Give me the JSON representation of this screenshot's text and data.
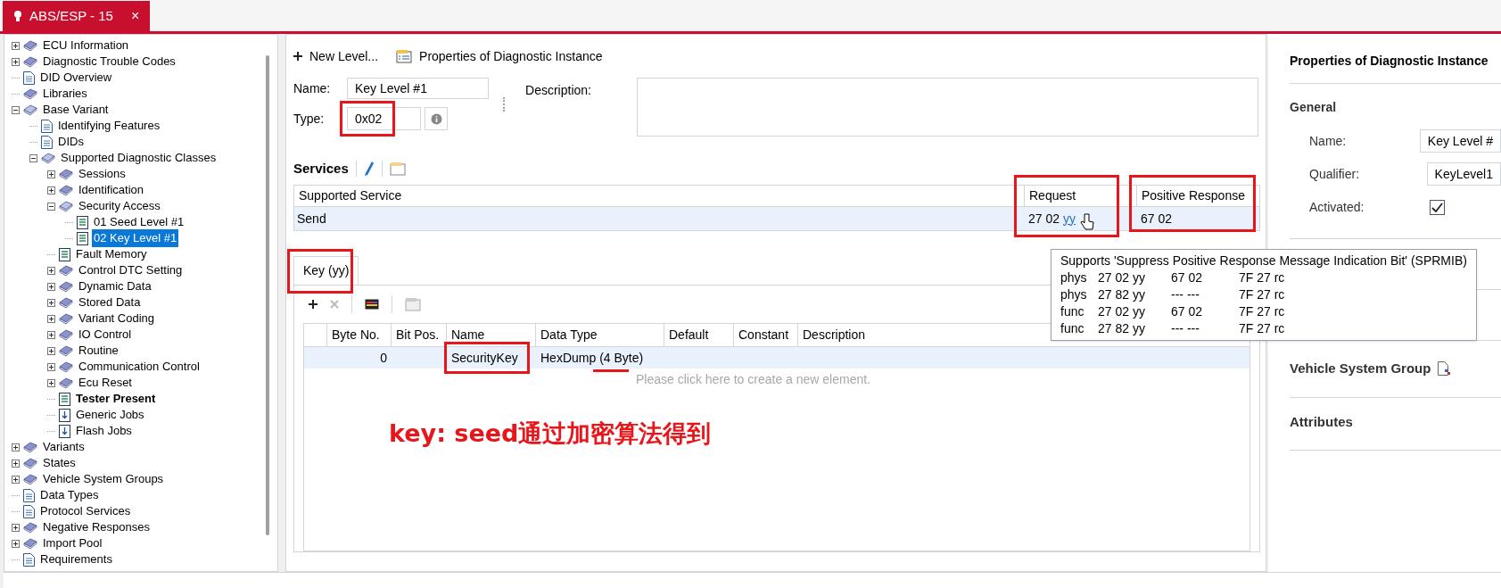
{
  "document_tab": {
    "title": "ABS/ESP - 15",
    "close": "×",
    "selected": true
  },
  "tree": [
    {
      "label": "ECU Information",
      "kind": "book",
      "expanded": false
    },
    {
      "label": "Diagnostic Trouble Codes",
      "kind": "book",
      "expanded": false
    },
    {
      "label": "DID Overview",
      "kind": "page"
    },
    {
      "label": "Libraries",
      "kind": "book"
    },
    {
      "label": "Base Variant",
      "kind": "openbook",
      "expanded": true,
      "children": [
        {
          "label": "Identifying Features",
          "kind": "page"
        },
        {
          "label": "DIDs",
          "kind": "page"
        },
        {
          "label": "Supported Diagnostic Classes",
          "kind": "openbook",
          "expanded": true,
          "children": [
            {
              "label": "Sessions",
              "kind": "book",
              "expanded": false
            },
            {
              "label": "Identification",
              "kind": "book",
              "expanded": false
            },
            {
              "label": "Security Access",
              "kind": "openbook",
              "expanded": true,
              "children": [
                {
                  "label": "01 Seed Level #1",
                  "kind": "sheet",
                  "selected": false
                },
                {
                  "label": "02 Key Level #1",
                  "kind": "sheet",
                  "selected": true
                }
              ]
            },
            {
              "label": "Fault Memory",
              "kind": "sheet"
            },
            {
              "label": "Control DTC Setting",
              "kind": "book",
              "expanded": false
            },
            {
              "label": "Dynamic Data",
              "kind": "book",
              "expanded": false
            },
            {
              "label": "Stored Data",
              "kind": "book",
              "expanded": false
            },
            {
              "label": "Variant Coding",
              "kind": "book",
              "expanded": false
            },
            {
              "label": "IO Control",
              "kind": "book",
              "expanded": false
            },
            {
              "label": "Routine",
              "kind": "book",
              "expanded": false
            },
            {
              "label": "Communication Control",
              "kind": "book",
              "expanded": false
            },
            {
              "label": "Ecu Reset",
              "kind": "book",
              "expanded": false
            },
            {
              "label": "Tester Present",
              "kind": "sheet",
              "bold": true
            },
            {
              "label": "Generic Jobs",
              "kind": "job"
            },
            {
              "label": "Flash Jobs",
              "kind": "job"
            }
          ]
        }
      ]
    },
    {
      "label": "Variants",
      "kind": "book",
      "expanded": false
    },
    {
      "label": "States",
      "kind": "book",
      "expanded": false
    },
    {
      "label": "Vehicle System Groups",
      "kind": "book",
      "expanded": false
    },
    {
      "label": "Data Types",
      "kind": "page"
    },
    {
      "label": "Protocol Services",
      "kind": "page"
    },
    {
      "label": "Negative Responses",
      "kind": "book",
      "expanded": false
    },
    {
      "label": "Import Pool",
      "kind": "book",
      "expanded": false
    },
    {
      "label": "Requirements",
      "kind": "page"
    }
  ],
  "toolbar": {
    "new_level": "New Level...",
    "properties": "Properties of Diagnostic Instance"
  },
  "form": {
    "name_label": "Name:",
    "name_value": "Key Level #1",
    "type_label": "Type:",
    "type_value": "0x02",
    "description_label": "Description:"
  },
  "services": {
    "title": "Services",
    "columns": [
      "Supported Service",
      "Request",
      "Positive Response"
    ],
    "rows": [
      {
        "service": "Send",
        "request": "27 02",
        "request_link": "yy",
        "positive_response": "67 02"
      }
    ]
  },
  "tooltip": {
    "title": "Supports 'Suppress Positive Response Message Indication Bit' (SPRMIB)",
    "rows": [
      [
        "phys",
        "27 02 yy",
        "67 02",
        "7F 27 rc"
      ],
      [
        "phys",
        "27 82 yy",
        "--- ---",
        "7F 27 rc"
      ],
      [
        "func",
        "27 02 yy",
        "67 02",
        "7F 27 rc"
      ],
      [
        "func",
        "27 82 yy",
        "--- ---",
        "7F 27 rc"
      ]
    ]
  },
  "key_tab": {
    "label": "Key (yy)",
    "selected": true
  },
  "params": {
    "columns": [
      "Byte No.",
      "Bit Pos.",
      "Name",
      "Data Type",
      "Default",
      "Constant",
      "Description"
    ],
    "rows": [
      [
        "0",
        "",
        "SecurityKey",
        "HexDump (4 Byte)",
        "",
        "",
        ""
      ]
    ],
    "placeholder": "Please click here to create a new element."
  },
  "annotation": "key: seed通过加密算法得到",
  "properties": {
    "title": "Properties of Diagnostic Instance",
    "general": "General",
    "fields": [
      {
        "kind": "text",
        "label": "Name:",
        "value": "Key Level #"
      },
      {
        "kind": "text",
        "label": "Qualifier:",
        "value": "KeyLevel1"
      },
      {
        "kind": "check",
        "label": "Activated:",
        "checked": true
      }
    ],
    "vehicle_system_group": "Vehicle System Group",
    "attributes": "Attributes"
  }
}
